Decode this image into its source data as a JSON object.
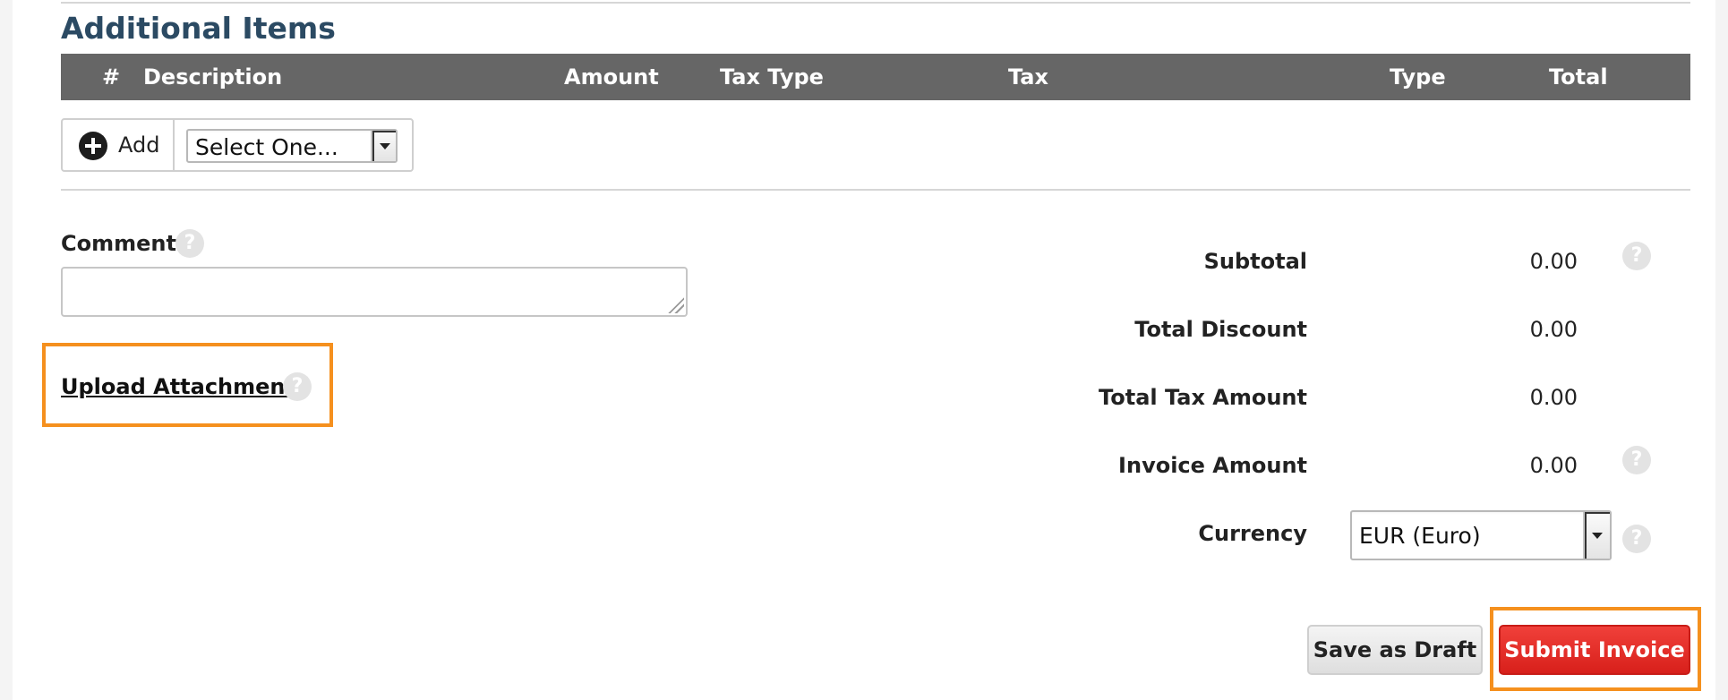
{
  "section": {
    "title": "Additional Items"
  },
  "table": {
    "columns": [
      "#",
      "Description",
      "Amount",
      "Tax Type",
      "Tax",
      "Type",
      "Total"
    ]
  },
  "add_row": {
    "add_label": "Add",
    "add_icon": "plus-circle-icon",
    "select_value": "Select One..."
  },
  "comment": {
    "label": "Comment",
    "value": ""
  },
  "upload": {
    "label": "Upload Attachment"
  },
  "summary": {
    "subtotal_label": "Subtotal",
    "subtotal_value": "0.00",
    "discount_label": "Total Discount",
    "discount_value": "0.00",
    "tax_label": "Total Tax Amount",
    "tax_value": "0.00",
    "invoice_label": "Invoice Amount",
    "invoice_value": "0.00",
    "currency_label": "Currency",
    "currency_value": "EUR (Euro)"
  },
  "help_icon_glyph": "?",
  "actions": {
    "draft_label": "Save as Draft",
    "submit_label": "Submit Invoice"
  },
  "colors": {
    "title": "#2b4a63",
    "table_header_bg": "#666666",
    "highlight": "#f5901e",
    "submit_bg": "#e02a25"
  }
}
